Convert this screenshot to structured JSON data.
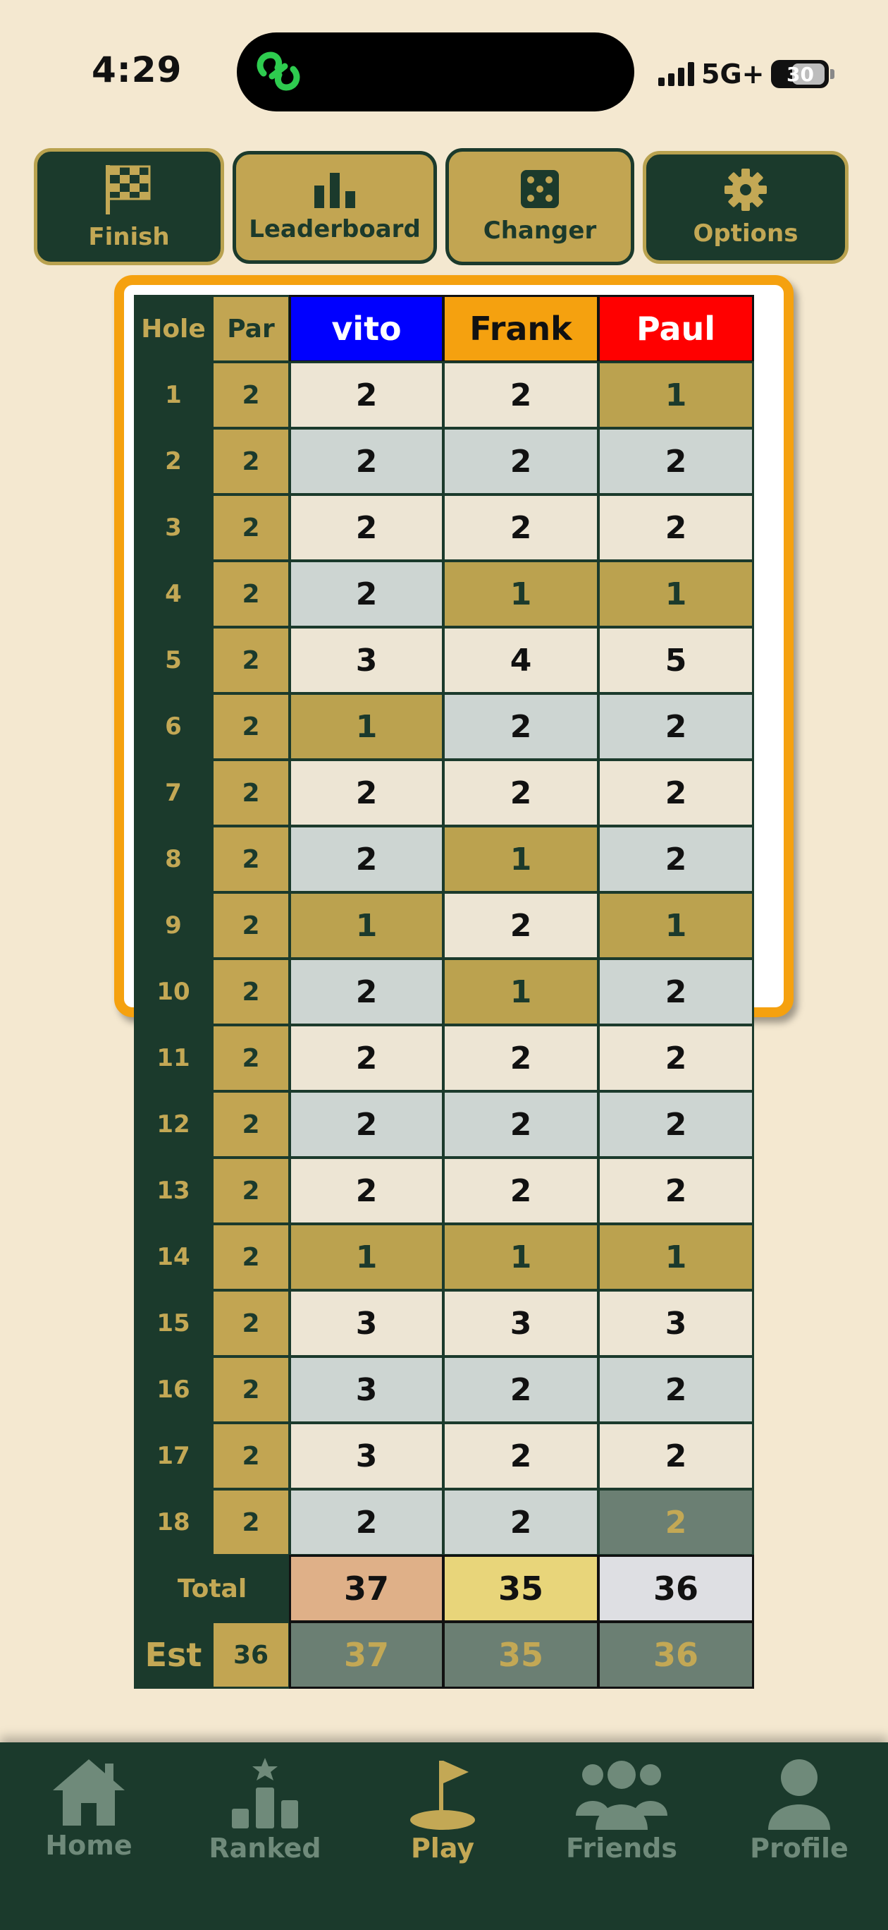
{
  "status": {
    "time": "4:29",
    "network": "5G+",
    "battery": "30"
  },
  "toolbar": {
    "buttons": [
      {
        "label": "Finish",
        "icon": "checkered-flag-icon"
      },
      {
        "label": "Leaderboard",
        "icon": "bar-chart-icon"
      },
      {
        "label": "Changer",
        "icon": "dice-icon"
      },
      {
        "label": "Options",
        "icon": "gear-icon"
      }
    ]
  },
  "scorecard": {
    "header": {
      "hole": "Hole",
      "par": "Par"
    },
    "players": [
      {
        "name": "vito",
        "color": "#0000ff",
        "text_color": "#ffffff"
      },
      {
        "name": "Frank",
        "color": "#f5a10f",
        "text_color": "#111111"
      },
      {
        "name": "Paul",
        "color": "#ff0000",
        "text_color": "#ffffff"
      }
    ],
    "rows": [
      {
        "hole": "1",
        "par": "2",
        "scores": [
          "2",
          "2",
          "1"
        ]
      },
      {
        "hole": "2",
        "par": "2",
        "scores": [
          "2",
          "2",
          "2"
        ]
      },
      {
        "hole": "3",
        "par": "2",
        "scores": [
          "2",
          "2",
          "2"
        ]
      },
      {
        "hole": "4",
        "par": "2",
        "scores": [
          "2",
          "1",
          "1"
        ]
      },
      {
        "hole": "5",
        "par": "2",
        "scores": [
          "3",
          "4",
          "5"
        ]
      },
      {
        "hole": "6",
        "par": "2",
        "scores": [
          "1",
          "2",
          "2"
        ]
      },
      {
        "hole": "7",
        "par": "2",
        "scores": [
          "2",
          "2",
          "2"
        ]
      },
      {
        "hole": "8",
        "par": "2",
        "scores": [
          "2",
          "1",
          "2"
        ]
      },
      {
        "hole": "9",
        "par": "2",
        "scores": [
          "1",
          "2",
          "1"
        ]
      },
      {
        "hole": "10",
        "par": "2",
        "scores": [
          "2",
          "1",
          "2"
        ]
      },
      {
        "hole": "11",
        "par": "2",
        "scores": [
          "2",
          "2",
          "2"
        ]
      },
      {
        "hole": "12",
        "par": "2",
        "scores": [
          "2",
          "2",
          "2"
        ]
      },
      {
        "hole": "13",
        "par": "2",
        "scores": [
          "2",
          "2",
          "2"
        ]
      },
      {
        "hole": "14",
        "par": "2",
        "scores": [
          "1",
          "1",
          "1"
        ]
      },
      {
        "hole": "15",
        "par": "2",
        "scores": [
          "3",
          "3",
          "3"
        ]
      },
      {
        "hole": "16",
        "par": "2",
        "scores": [
          "3",
          "2",
          "2"
        ]
      },
      {
        "hole": "17",
        "par": "2",
        "scores": [
          "3",
          "2",
          "2"
        ]
      },
      {
        "hole": "18",
        "par": "2",
        "scores": [
          "2",
          "2",
          "2"
        ]
      }
    ],
    "total": {
      "label": "Total",
      "values": [
        "37",
        "35",
        "36"
      ],
      "colors": [
        "#dfb088",
        "#e8d57a",
        "#dedfe3"
      ]
    },
    "est": {
      "label": "Est",
      "par": "36",
      "values": [
        "37",
        "35",
        "36"
      ]
    },
    "colors": {
      "light_row": "#ede5d4",
      "alt_row": "#cdd5d2",
      "birdie": "#bba24f",
      "birdie_text": "#1b3a2c",
      "selected": "#6b7f73",
      "selected_text": "#c3a855"
    },
    "selected_cell": {
      "hole": "18",
      "player": "Paul"
    }
  },
  "nav": {
    "items": [
      {
        "label": "Home",
        "icon": "home-icon"
      },
      {
        "label": "Ranked",
        "icon": "ranked-podium-icon"
      },
      {
        "label": "Play",
        "icon": "golf-flag-icon"
      },
      {
        "label": "Friends",
        "icon": "friends-icon"
      },
      {
        "label": "Profile",
        "icon": "profile-icon"
      }
    ],
    "active": "Play"
  }
}
